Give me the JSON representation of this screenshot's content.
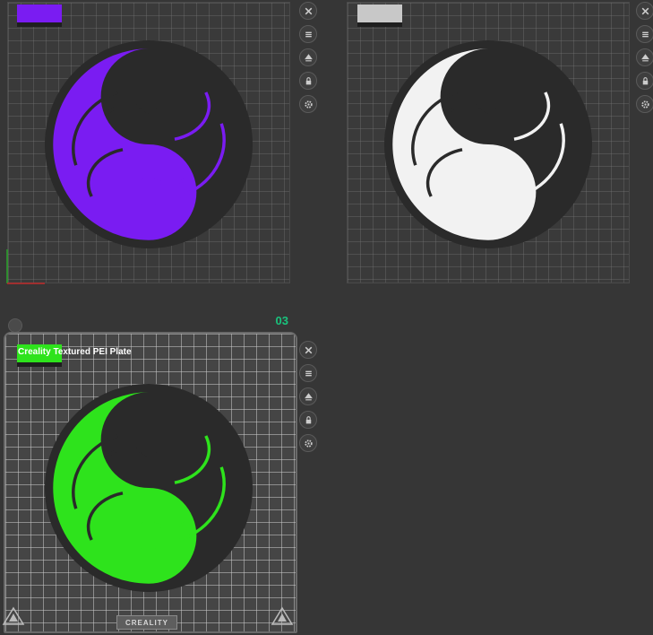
{
  "colors": {
    "background": "#363636",
    "plate1_filament": "#7a1cf2",
    "plate2_filament": "#f2f2f2",
    "plate3_filament": "#2ee31c",
    "dark_filament": "#2a2a2a",
    "plate_number": "#19c37d"
  },
  "plates": [
    {
      "filament_color": "#7a1cf2",
      "model": "yin-yang-rose"
    },
    {
      "filament_color": "#f2f2f2",
      "model": "yin-yang-rose"
    },
    {
      "filament_color": "#2ee31c",
      "model": "yin-yang-rose"
    }
  ],
  "active_plate": {
    "number": "03",
    "name": "Creality Textured PEI Plate",
    "brand": "CREALITY"
  },
  "toolbar_icons": [
    "close-icon",
    "list-icon",
    "arrange-icon",
    "lock-icon",
    "gear-icon"
  ]
}
